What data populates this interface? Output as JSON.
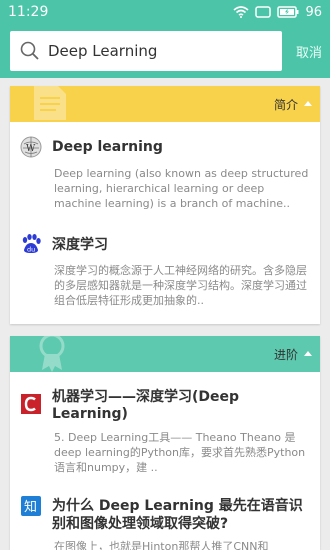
{
  "status_bar": {
    "time": "11:29",
    "battery": "96"
  },
  "search": {
    "query": "Deep Learning",
    "cancel_label": "取消"
  },
  "section_intro": {
    "tab_label": "简介",
    "results": [
      {
        "title": "Deep learning",
        "source_icon": "wikipedia-icon",
        "description": "Deep learning (also known as deep structured learning, hierarchical learning or deep machine learning) is a branch of machine.."
      },
      {
        "title": "深度学习",
        "source_icon": "baidu-icon",
        "description": "深度学习的概念源于人工神经网络的研究。含多隐层的多层感知器就是一种深度学习结构。深度学习通过组合低层特征形成更加抽象的.."
      }
    ]
  },
  "section_advanced": {
    "tab_label": "进阶",
    "results": [
      {
        "title": "机器学习——深度学习(Deep Learning)",
        "source_icon": "csdn-icon",
        "description": "5. Deep Learning工具—— Theano Theano 是deep learning的Python库，要求首先熟悉Python语言和numpy，建 .."
      },
      {
        "title": "为什么 Deep Learning 最先在语音识别和图像处理领域取得突破?",
        "source_icon": "zhihu-icon",
        "description": "在图像上，也就是Hinton那帮人推了CNN和CONVNET出来，能用GPU跑，才突然大火起"
      }
    ]
  },
  "colors": {
    "accent": "#4cc4a8",
    "intro_header": "#f8d24a",
    "advanced_header": "#5dc9ae"
  }
}
